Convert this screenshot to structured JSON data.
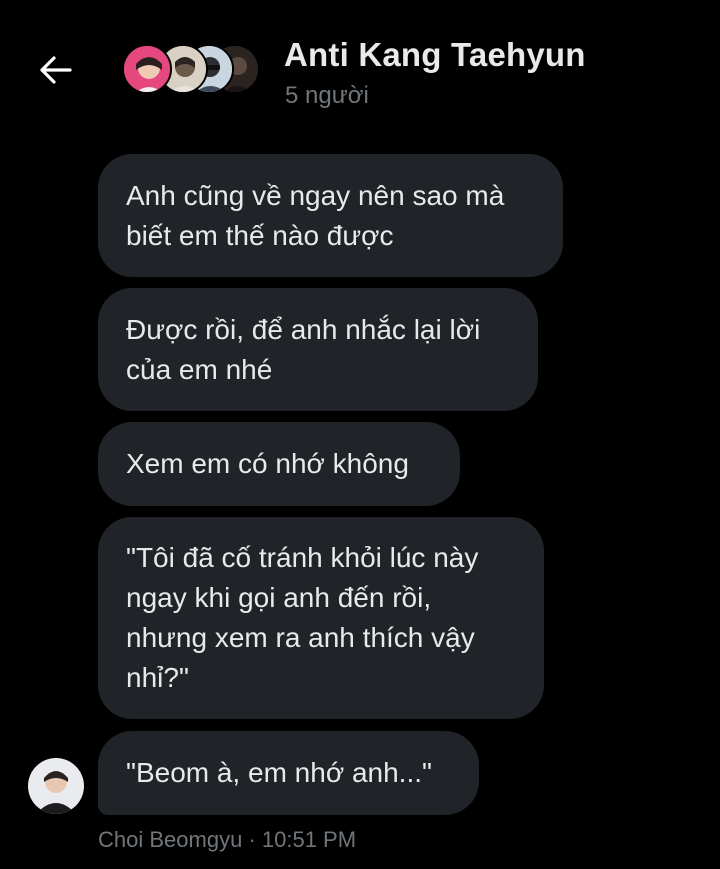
{
  "header": {
    "back_icon": "arrow-left-icon",
    "title": "Anti Kang Taehyun",
    "subtitle": "5 người",
    "avatar_colors": [
      "#e8407a",
      "#b9b2a6",
      "#8aa6c0",
      "#3b302c"
    ]
  },
  "messages": [
    {
      "text": "Anh cũng về ngay nên sao mà biết em thế nào được"
    },
    {
      "text": "Được rồi, để anh nhắc lại lời của em nhé"
    },
    {
      "text": "Xem em có nhớ không"
    },
    {
      "text": "\"Tôi đã cố tránh khỏi lúc này ngay khi gọi anh đến rồi, nhưng xem ra anh thích vậy nhỉ?\""
    },
    {
      "text": "\"Beom à, em nhớ anh...\""
    }
  ],
  "footer": {
    "sender": "Choi Beomgyu",
    "separator": "·",
    "time": "10:51 PM"
  },
  "colors": {
    "background": "#000000",
    "bubble": "#202327",
    "text": "#e7e9ea",
    "muted": "#71767b"
  }
}
